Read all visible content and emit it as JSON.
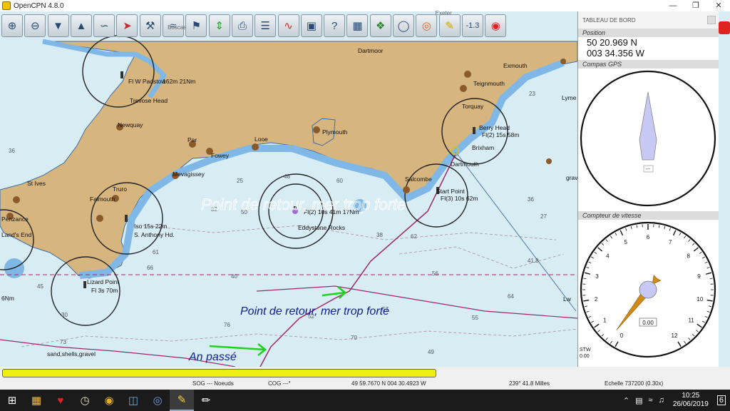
{
  "window": {
    "title": "OpenCPN 4.8.0"
  },
  "toolbar": {
    "tooltip_left": "Boscastle",
    "tooltip_right": "Exeter",
    "zoom_readout": "-1.3",
    "icons": [
      "zoom-in",
      "zoom-out",
      "scale-down",
      "scale-up",
      "route",
      "mark",
      "settings",
      "tide",
      "print",
      "ais",
      "tracks",
      "chart-groups",
      "help",
      "dashboard",
      "grib",
      "measure",
      "drop-marker",
      "zoom-level",
      "mob"
    ]
  },
  "map": {
    "places": [
      {
        "label": "Dartmoor"
      },
      {
        "label": "Exmouth"
      },
      {
        "label": "Teignmouth"
      },
      {
        "label": "Lyme"
      },
      {
        "label": "Torquay"
      },
      {
        "label": "Berry Head"
      },
      {
        "label": "Fl(2) 15s 58m"
      },
      {
        "label": "Brixham"
      },
      {
        "label": "Dartmouth"
      },
      {
        "label": "Trevose Head"
      },
      {
        "label": "Fl W Padstow"
      },
      {
        "label": "162m 21Nm"
      },
      {
        "label": "Newquay"
      },
      {
        "label": "Par"
      },
      {
        "label": "Looe"
      },
      {
        "label": "Plymouth"
      },
      {
        "label": "Fowey"
      },
      {
        "label": "Mevagissey"
      },
      {
        "label": "Salcombe"
      },
      {
        "label": "Start Point"
      },
      {
        "label": "Fl(3) 10s 62m"
      },
      {
        "label": "St Ives"
      },
      {
        "label": "Truro"
      },
      {
        "label": "Falmouth"
      },
      {
        "label": "Iso 15s 22m"
      },
      {
        "label": "S. Anthony Hd."
      },
      {
        "label": "Penzance"
      },
      {
        "label": "Eddystone Rocks"
      },
      {
        "label": "Fl(2) 10s 41m 17Nm"
      },
      {
        "label": "Lizard Point"
      },
      {
        "label": "Fl 3s 70m"
      },
      {
        "label": "Land's End"
      },
      {
        "label": "sand,shells,gravel"
      },
      {
        "label": "grav"
      },
      {
        "label": "6Nm"
      },
      {
        "label": "Lw"
      }
    ],
    "depths": [
      "62",
      "48",
      "41.8",
      "36",
      "61",
      "60",
      "66",
      "45",
      "40",
      "32",
      "30",
      "73",
      "76",
      "70",
      "25",
      "56",
      "50",
      "38",
      "36",
      "23",
      "64",
      "55",
      "49",
      "27",
      "57",
      "52"
    ],
    "watermark": "Point de retour, mer trop forte",
    "annotations": {
      "return_point": "Point de retour, mer trop forte",
      "passed": "An passé"
    },
    "colors": {
      "land": "#d7b57f",
      "shallow": "#7fb8e6",
      "deep": "#d8ecf4",
      "track": "#9b2a6a",
      "arrow": "#2ad02a"
    }
  },
  "dashboard": {
    "header": "TABLEAU DE BORD",
    "position": {
      "title": "Position",
      "lat": "50 20.969 N",
      "lon": "003 34.356 W"
    },
    "compass": {
      "title": "Compas GPS",
      "heading": 0,
      "readout": "---"
    },
    "speedometer": {
      "title": "Compteur de vitesse",
      "ticks": [
        "0",
        "1",
        "2",
        "3",
        "4",
        "5",
        "6",
        "7",
        "8",
        "9",
        "10",
        "11",
        "12"
      ],
      "value": 0.0,
      "readout": "0.00",
      "stw_label": "STW",
      "stw_value": "0.00",
      "needle_angle": 218
    }
  },
  "status": {
    "progress": 1.0,
    "sog": "SOG --- Noeuds",
    "cog": "COG ---°",
    "cursor_pos": "49 59.7670 N   004 30.4923 W",
    "bearing_dist": "239°   41.8 Milles",
    "scale": "Echelle 737200 (0.30x)"
  },
  "taskbar": {
    "time": "10:25",
    "date": "26/06/2019",
    "notifications": "6"
  }
}
